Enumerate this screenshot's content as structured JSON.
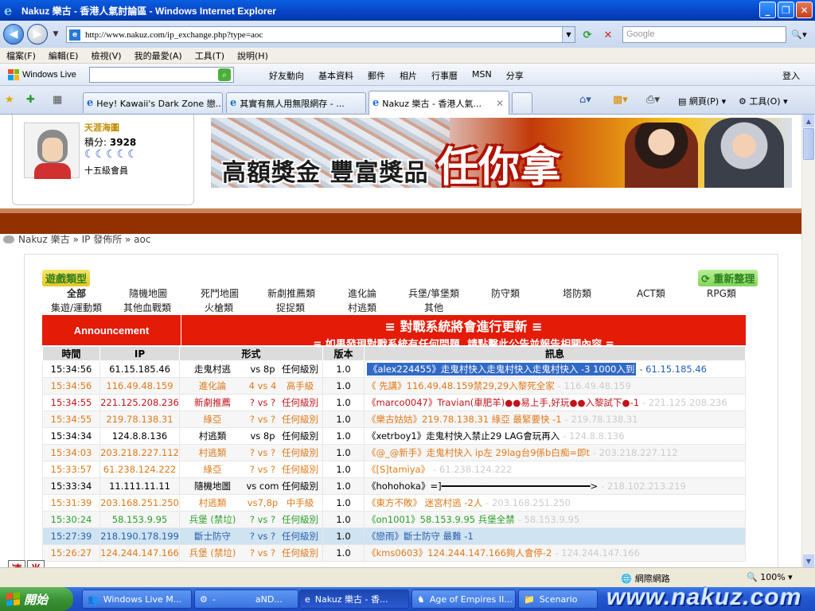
{
  "window": {
    "title": "Nakuz 樂古 - 香港人氣討論區 - Windows Internet Explorer",
    "url": "http://www.nakuz.com/ip_exchange.php?type=aoc",
    "search_placeholder": "Google"
  },
  "menu": [
    "檔案(F)",
    "編輯(E)",
    "檢視(V)",
    "我的最愛(A)",
    "工具(T)",
    "說明(H)"
  ],
  "live_toolbar": {
    "brand": "Windows Live",
    "links": [
      "好友動向",
      "基本資料",
      "郵件",
      "相片",
      "行事曆",
      "MSN",
      "分享"
    ],
    "signin": "登入"
  },
  "tabs": [
    {
      "label": "Hey! Kawaii's Dark Zone 戀..."
    },
    {
      "label": "其實有無人用無限網存 - ..."
    },
    {
      "label": "Nakuz 樂古 - 香港人氣..."
    }
  ],
  "command_bar": {
    "page": "網頁(P)",
    "tools": "工具(O)"
  },
  "user": {
    "name": "天涯海圖",
    "points_label": "積分:",
    "points": "3928",
    "moons": "☾☾☾☾☾",
    "rank": "十五級會員"
  },
  "banner": {
    "line1": "高額獎金 豐富獎品",
    "line2": "任你拿"
  },
  "breadcrumb": "Nakuz 樂古 » IP 發佈所 » aoc",
  "game_type_title": "遊戲類型",
  "refresh_label": "重新整理",
  "categories_row1": [
    "全部",
    "隨機地圖",
    "死鬥地圖",
    "新劇推薦類",
    "進化論",
    "兵堡/箏堡類",
    "防守類",
    "塔防類",
    "ACT類",
    "RPG類"
  ],
  "categories_row2": [
    "集遊/運動類",
    "其他血戰類",
    "火槍類",
    "捉捉類",
    "村逃類",
    "其他"
  ],
  "announcement": {
    "label": "Announcement",
    "line1": "≡ 對戰系統將會進行更新 ≡",
    "line2": "≡ 如果發現對戰系統有任何問題, 請點擊此公告並報告相關內容 ≡"
  },
  "table": {
    "headers": [
      "時間",
      "IP",
      "形式",
      "版本",
      "訊息"
    ],
    "rows": [
      {
        "time": "15:34:56",
        "ip": "61.15.185.46",
        "type": "走鬼村逃",
        "players": "vs 8p",
        "level": "任何級別",
        "ver": "1.0",
        "msg": "《alex224455》走鬼村快入走鬼村快入走鬼村快入  -3 1000入到",
        "msg_ip": "- 61.15.185.46",
        "color": "#000000",
        "msg_color": "#ffffff",
        "msg_bg": "#3169c6"
      },
      {
        "time": "15:34:56",
        "ip": "116.49.48.159",
        "type": "進化論",
        "players": "4 vs 4",
        "level": "高手級",
        "ver": "1.0",
        "msg": "《  先講》116.49.48.159禁29,29入黎死全家",
        "msg_ip": "- 116.49.48.159",
        "color": "#e07a1a",
        "msg_color": "#e07a1a",
        "msg_bg": ""
      },
      {
        "time": "15:34:55",
        "ip": "221.125.208.236",
        "type": "新劇推薦",
        "players": "? vs ?",
        "level": "任何級別",
        "ver": "1.0",
        "msg": "《marco0047》Travian(車肥羊)●●易上手,好玩●●入黎試下●-1",
        "msg_ip": "- 221.125.208.236",
        "color": "#c0131b",
        "msg_color": "#c0131b",
        "msg_bg": ""
      },
      {
        "time": "15:34:55",
        "ip": "219.78.138.31",
        "type": "綠亞",
        "players": "? vs ?",
        "level": "任何級別",
        "ver": "1.0",
        "msg": "《樂古姑姑》219.78.138.31 綠亞 最緊要快 -1",
        "msg_ip": "- 219.78.138.31",
        "color": "#e07a1a",
        "msg_color": "#e07a1a",
        "msg_bg": ""
      },
      {
        "time": "15:34:34",
        "ip": "124.8.8.136",
        "type": "村逃類",
        "players": "vs 8p",
        "level": "任何級別",
        "ver": "1.0",
        "msg": "《xetrboy1》走鬼村快入禁止29 LAG會玩再入",
        "msg_ip": "- 124.8.8.136",
        "color": "#000000",
        "msg_color": "#000000",
        "msg_bg": ""
      },
      {
        "time": "15:34:03",
        "ip": "203.218.227.112",
        "type": "村逃類",
        "players": "? vs ?",
        "level": "任何級別",
        "ver": "1.0",
        "msg": "《@_@新手》走鬼村快入 ip左 29lag台9係b白痴=即t",
        "msg_ip": "- 203.218.227.112",
        "color": "#e07a1a",
        "msg_color": "#e07a1a",
        "msg_bg": ""
      },
      {
        "time": "15:33:57",
        "ip": "61.238.124.222",
        "type": "綠亞",
        "players": "? vs ?",
        "level": "任何級別",
        "ver": "1.0",
        "msg": "《[S]tamiya》",
        "msg_ip": "- 61.238.124.222",
        "color": "#e07a1a",
        "msg_color": "#e07a1a",
        "msg_bg": ""
      },
      {
        "time": "15:33:34",
        "ip": "11.111.11.11",
        "type": "隨機地圖",
        "players": "vs com",
        "level": "任何級別",
        "ver": "1.0",
        "msg": "《hohohoka》=]━━━━━━━━━━━━━━━━━━━━━━━━━━━>",
        "msg_ip": "- 218.102.213.219",
        "color": "#000000",
        "msg_color": "#000000",
        "msg_bg": ""
      },
      {
        "time": "15:31:39",
        "ip": "203.168.251.250",
        "type": "村逃類",
        "players": "vs7,8p",
        "level": "中手級",
        "ver": "1.0",
        "msg": "《東方不敗》       迷宮村逃       -2人",
        "msg_ip": "- 203.168.251.250",
        "color": "#e07a1a",
        "msg_color": "#e07a1a",
        "msg_bg": ""
      },
      {
        "time": "15:30:24",
        "ip": "58.153.9.95",
        "type": "兵堡 (禁垃)",
        "players": "? vs ?",
        "level": "任何級別",
        "ver": "1.0",
        "msg": "《on1001》58.153.9.95 兵堡全禁",
        "msg_ip": "- 58.153.9.95",
        "color": "#2ca02c",
        "msg_color": "#2ca02c",
        "msg_bg": ""
      },
      {
        "time": "15:27:39",
        "ip": "218.190.178.199",
        "type": "斷士防守",
        "players": "? vs ?",
        "level": "任何級別",
        "ver": "1.0",
        "msg": "《戀雨》斷士防守 最難 -1",
        "msg_ip": "",
        "color": "#2a5fb0",
        "msg_color": "#2a5fb0",
        "msg_bg": "",
        "highlight": true
      },
      {
        "time": "15:26:27",
        "ip": "124.244.147.166",
        "type": "兵堡 (禁垃)",
        "players": "? vs ?",
        "level": "任何級別",
        "ver": "1.0",
        "msg": "《kms0603》124.244.147.166夠人會停-2",
        "msg_ip": "- 124.244.147.166",
        "color": "#e07a1a",
        "msg_color": "#e07a1a",
        "msg_bg": ""
      }
    ]
  },
  "status": {
    "zone": "網際網路",
    "zoom": "100%"
  },
  "ime": [
    "速",
    "半"
  ],
  "taskbar": {
    "start": "開始",
    "tasks": [
      "Windows Live M...",
      "-",
      "aND...",
      "Nakuz 樂古 - 香...",
      "Age of Empires II...",
      "Scenario"
    ]
  },
  "watermark": "www.nakuz.com",
  "colors": {
    "title_blue": "#0743c4",
    "announce_red": "#e31b07",
    "band_brown": "#933000"
  }
}
